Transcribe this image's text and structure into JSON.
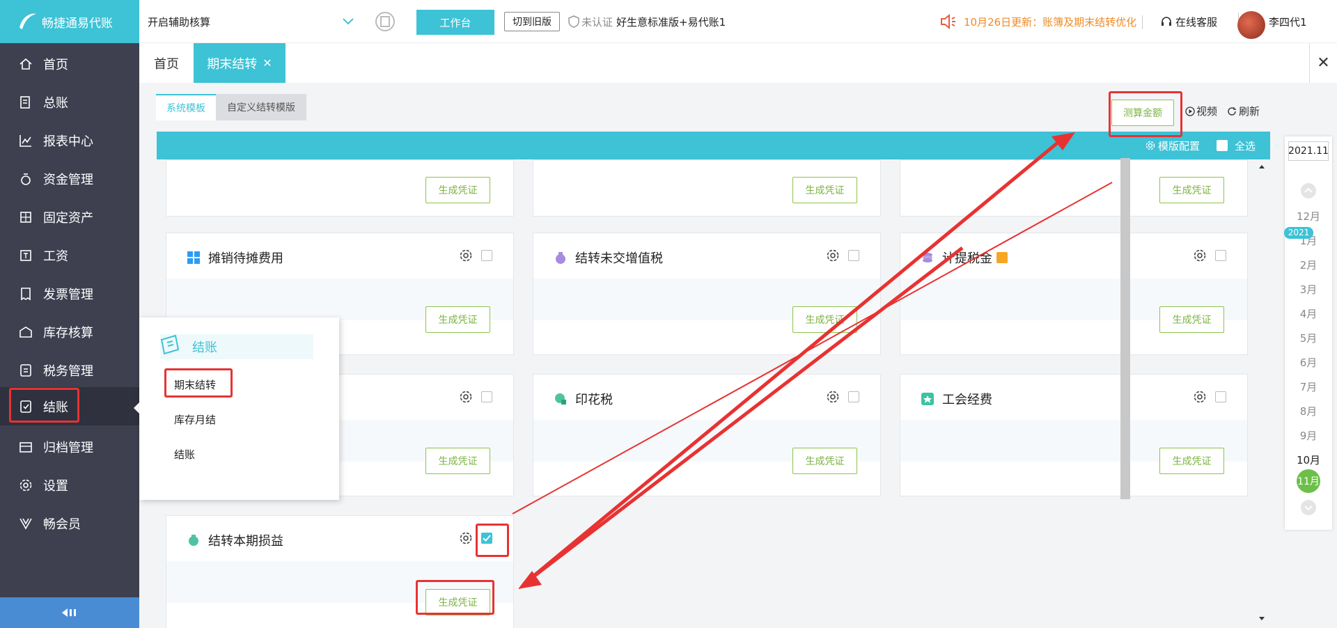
{
  "brand": {
    "name": "畅捷通易代账"
  },
  "header": {
    "assist_toggle": "开启辅助核算",
    "workbench": "工作台",
    "switch_old": "切到旧版",
    "unverified": "未认证",
    "company": "好生意标准版+易代账1",
    "announcement": "10月26日更新：账簿及期末结转优化",
    "service": "在线客服",
    "user": "李四代1"
  },
  "sidebar": {
    "items": [
      {
        "label": "首页",
        "icon": "home-icon"
      },
      {
        "label": "总账",
        "icon": "ledger-icon"
      },
      {
        "label": "报表中心",
        "icon": "report-icon"
      },
      {
        "label": "资金管理",
        "icon": "money-icon"
      },
      {
        "label": "固定资产",
        "icon": "asset-icon"
      },
      {
        "label": "工资",
        "icon": "salary-icon"
      },
      {
        "label": "发票管理",
        "icon": "invoice-icon"
      },
      {
        "label": "库存核算",
        "icon": "inventory-icon"
      },
      {
        "label": "税务管理",
        "icon": "tax-icon"
      },
      {
        "label": "结账",
        "icon": "closing-icon"
      },
      {
        "label": "归档管理",
        "icon": "archive-icon"
      },
      {
        "label": "设置",
        "icon": "settings-icon"
      },
      {
        "label": "畅会员",
        "icon": "vip-icon"
      }
    ]
  },
  "tabs": {
    "home": "首页",
    "active": "期末结转"
  },
  "content": {
    "subtabs": [
      "系统模板",
      "自定义结转模版"
    ],
    "calc_amount": "测算金额",
    "video": "视频",
    "refresh": "刷新",
    "template_config": "模版配置",
    "select_all": "全选",
    "gen_voucher": "生成凭证",
    "cards": [
      {
        "title": "摊销待摊费用",
        "icon": "windows-grid-icon",
        "checked": false
      },
      {
        "title": "结转未交增值税",
        "icon": "money-bag-icon",
        "checked": false
      },
      {
        "title": "计提税金",
        "icon": "coins-icon",
        "checked": false
      },
      {
        "title": "",
        "checked": false
      },
      {
        "title": "印花税",
        "icon": "stamp-icon",
        "checked": false
      },
      {
        "title": "工会经费",
        "icon": "union-icon",
        "checked": false
      },
      {
        "title": "结转本期损益",
        "icon": "profit-icon",
        "checked": true
      }
    ]
  },
  "period": {
    "current": "2021.11",
    "year": "2021",
    "months": [
      "12月",
      "1月",
      "2月",
      "3月",
      "4月",
      "5月",
      "6月",
      "7月",
      "8月",
      "9月",
      "10月",
      "11月"
    ],
    "selected": "11月"
  },
  "popup": {
    "title": "结账",
    "items": [
      "期末结转",
      "库存月结",
      "结账"
    ]
  },
  "colors": {
    "accent": "#3dc2d6",
    "sidebar": "#3e4050",
    "green": "#7cb342",
    "annotation": "#e83232"
  }
}
